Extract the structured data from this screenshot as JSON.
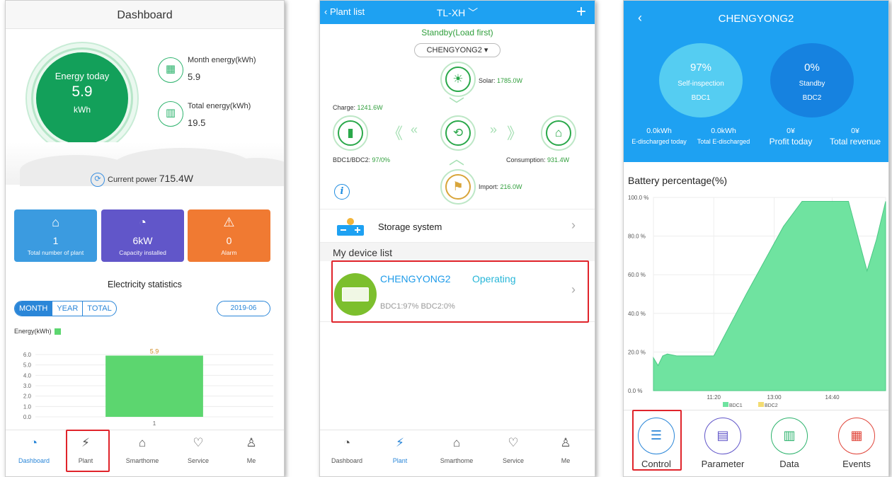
{
  "screen1": {
    "title": "Dashboard",
    "energy_today": {
      "label": "Energy today",
      "value": "5.9",
      "unit": "kWh"
    },
    "month_energy": {
      "label": "Month energy(kWh)",
      "value": "5.9"
    },
    "total_energy": {
      "label": "Total energy(kWh)",
      "value": "19.5"
    },
    "current_power": {
      "label": "Current power",
      "value": "715.4W"
    },
    "tiles": [
      {
        "value": "1",
        "label": "Total number of plant",
        "color": "#3b9be0",
        "icon": "home-icon"
      },
      {
        "value": "6kW",
        "label": "Capacity installed",
        "color": "#6156c9",
        "icon": "gauge-icon"
      },
      {
        "value": "0",
        "label": "Alarm",
        "color": "#f07a32",
        "icon": "alarm-icon"
      }
    ],
    "stats_title": "Electricity statistics",
    "range_tabs": [
      "MONTH",
      "YEAR",
      "TOTAL"
    ],
    "selected_range": "MONTH",
    "date": "2019-06",
    "legend": "Energy(kWh)",
    "chart_data": {
      "type": "bar",
      "categories": [
        "1"
      ],
      "values": [
        5.9
      ],
      "data_labels": [
        "5.9"
      ],
      "ylim": [
        0,
        6.0
      ],
      "yticks": [
        "6.0",
        "5.0",
        "4.0",
        "3.0",
        "2.0",
        "1.0",
        "0.0"
      ],
      "legend": [
        "Energy(kWh)"
      ],
      "bar_color": "#5cd66f"
    },
    "tabs": [
      "Dashboard",
      "Plant",
      "Smarthome",
      "Service",
      "Me"
    ],
    "active_tab": "Dashboard"
  },
  "screen2": {
    "back_label": "Plant list",
    "title": "TL-XH",
    "standby": "Standby(Load first)",
    "plant": "CHENGYONG2",
    "solar": {
      "label": "Solar:",
      "value": "1785.0W"
    },
    "charge": {
      "label": "Charge:",
      "value": "1241.6W"
    },
    "bdc": {
      "label": "BDC1/BDC2:",
      "value": "97/0%"
    },
    "consumption": {
      "label": "Consumption:",
      "value": "931.4W"
    },
    "import": {
      "label": "Import:",
      "value": "216.0W"
    },
    "storage_label": "Storage system",
    "device_list_title": "My device list",
    "device": {
      "name": "CHENGYONG2",
      "status": "Operating",
      "sub": "BDC1:97% BDC2:0%"
    },
    "tabs": [
      "Dashboard",
      "Plant",
      "Smarthome",
      "Service",
      "Me"
    ],
    "active_tab": "Plant"
  },
  "screen3": {
    "title": "CHENGYONG2",
    "bdc1": {
      "percent": "97%",
      "status": "Self-inspection",
      "name": "BDC1"
    },
    "bdc2": {
      "percent": "0%",
      "status": "Standby",
      "name": "BDC2"
    },
    "stats": [
      {
        "value": "0.0kWh",
        "label": "E-discharged today"
      },
      {
        "value": "0.0kWh",
        "label": "Total E-discharged"
      },
      {
        "value": "0¥",
        "label": "Profit today"
      },
      {
        "value": "0¥",
        "label": "Total revenue"
      }
    ],
    "chart_title": "Battery percentage(%)",
    "chart_data": {
      "type": "area",
      "series": [
        {
          "name": "BDC1",
          "color": "#6fe3a0",
          "x": [
            0,
            2,
            4,
            6,
            10,
            18,
            26,
            40,
            56,
            64,
            70,
            74,
            80,
            84,
            88,
            92,
            96,
            100
          ],
          "y": [
            17,
            13,
            18,
            19,
            18,
            18,
            18,
            50,
            85,
            98,
            98,
            98,
            98,
            98,
            80,
            62,
            78,
            98
          ]
        },
        {
          "name": "BDC2",
          "color": "#f3dc73",
          "x": [],
          "y": []
        }
      ],
      "ylim": [
        0,
        100
      ],
      "yticks": [
        "100.0 %",
        "80.0 %",
        "60.0 %",
        "40.0 %",
        "20.0 %",
        "0.0 %"
      ],
      "xticks": [
        "11:20",
        "13:00",
        "14:40"
      ],
      "legend": [
        "BDC1",
        "BDC2"
      ],
      "legend_position": "bottom"
    },
    "nav": [
      {
        "label": "Control",
        "color": "#2a86d8",
        "icon": "sliders-icon"
      },
      {
        "label": "Parameter",
        "color": "#6156c9",
        "icon": "list-icon"
      },
      {
        "label": "Data",
        "color": "#2db36d",
        "icon": "bar-chart-icon"
      },
      {
        "label": "Events",
        "color": "#e0453a",
        "icon": "document-icon"
      }
    ]
  }
}
